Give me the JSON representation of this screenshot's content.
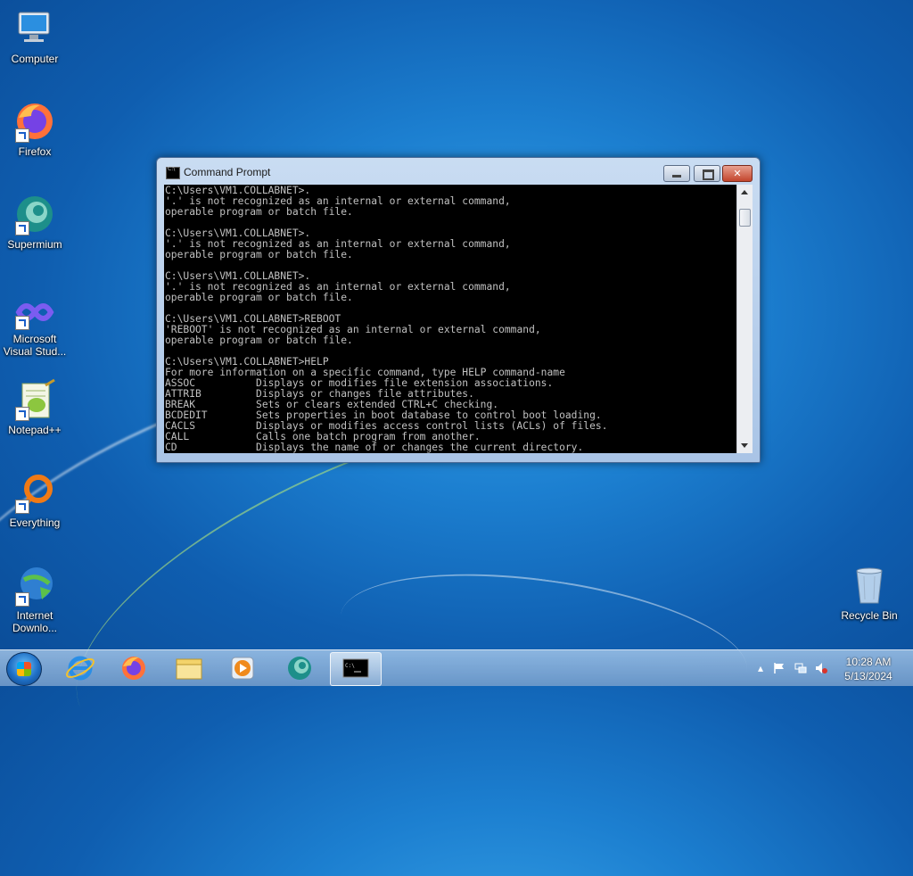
{
  "desktop": {
    "icons": [
      {
        "label": "Computer"
      },
      {
        "label": "Firefox"
      },
      {
        "label": "Supermium"
      },
      {
        "label": "Microsoft Visual Stud..."
      },
      {
        "label": "Notepad++"
      },
      {
        "label": "Everything"
      },
      {
        "label": "Internet Downlo..."
      },
      {
        "label": "Recycle Bin"
      }
    ]
  },
  "window": {
    "title": "Command Prompt",
    "console_text": "C:\\Users\\VM1.COLLABNET>.\n'.' is not recognized as an internal or external command,\noperable program or batch file.\n\nC:\\Users\\VM1.COLLABNET>.\n'.' is not recognized as an internal or external command,\noperable program or batch file.\n\nC:\\Users\\VM1.COLLABNET>.\n'.' is not recognized as an internal or external command,\noperable program or batch file.\n\nC:\\Users\\VM1.COLLABNET>REBOOT\n'REBOOT' is not recognized as an internal or external command,\noperable program or batch file.\n\nC:\\Users\\VM1.COLLABNET>HELP\nFor more information on a specific command, type HELP command-name\nASSOC          Displays or modifies file extension associations.\nATTRIB         Displays or changes file attributes.\nBREAK          Sets or clears extended CTRL+C checking.\nBCDEDIT        Sets properties in boot database to control boot loading.\nCACLS          Displays or modifies access control lists (ACLs) of files.\nCALL           Calls one batch program from another.\nCD             Displays the name of or changes the current directory."
  },
  "taskbar": {
    "apps": [
      {
        "name": "internet-explorer-icon"
      },
      {
        "name": "firefox-icon"
      },
      {
        "name": "file-explorer-icon"
      },
      {
        "name": "media-player-icon"
      },
      {
        "name": "supermium-icon"
      },
      {
        "name": "command-prompt-icon"
      }
    ],
    "clock": {
      "time": "10:28 AM",
      "date": "5/13/2024"
    }
  }
}
